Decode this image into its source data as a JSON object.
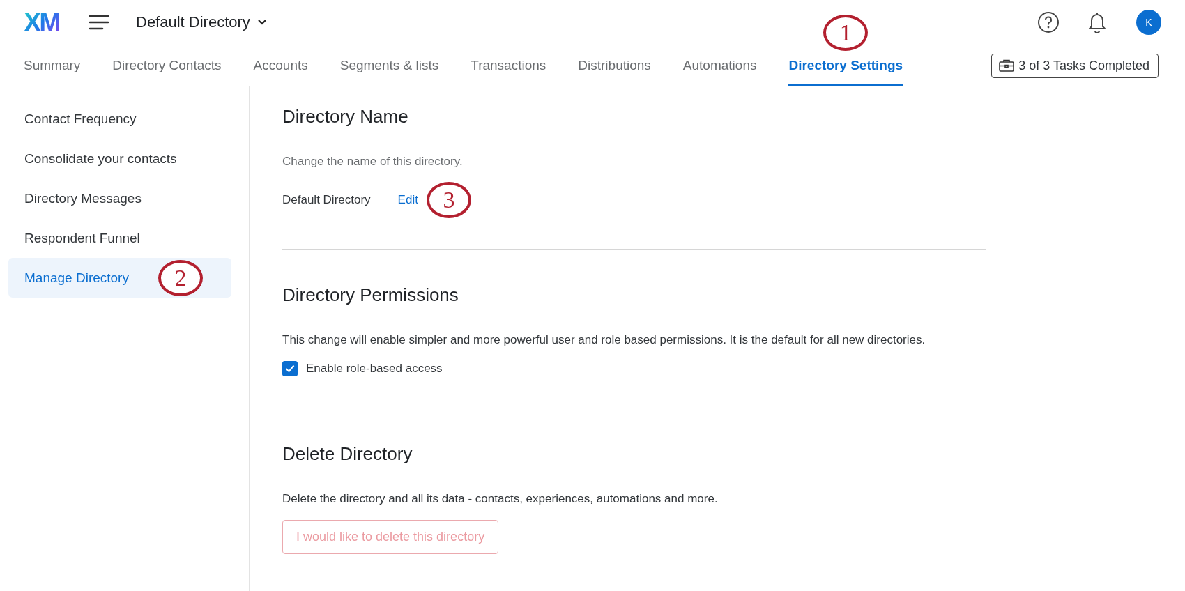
{
  "header": {
    "logo": "XM",
    "directory": "Default Directory",
    "avatar": "K"
  },
  "tabs": [
    {
      "label": "Summary",
      "selected": false
    },
    {
      "label": "Directory Contacts",
      "selected": false
    },
    {
      "label": "Accounts",
      "selected": false
    },
    {
      "label": "Segments & lists",
      "selected": false
    },
    {
      "label": "Transactions",
      "selected": false
    },
    {
      "label": "Distributions",
      "selected": false
    },
    {
      "label": "Automations",
      "selected": false
    },
    {
      "label": "Directory Settings",
      "selected": true,
      "callout": "1"
    }
  ],
  "tasks_button": "3 of 3 Tasks Completed",
  "sidebar": {
    "items": [
      {
        "label": "Contact Frequency",
        "selected": false
      },
      {
        "label": "Consolidate your contacts",
        "selected": false
      },
      {
        "label": "Directory Messages",
        "selected": false
      },
      {
        "label": "Respondent Funnel",
        "selected": false
      },
      {
        "label": "Manage Directory",
        "selected": true,
        "callout": "2"
      }
    ]
  },
  "sections": [
    {
      "kind": "name",
      "title": "Directory Name",
      "description": "Change the name of this directory.",
      "value": "Default Directory",
      "link": "Edit",
      "callout": "3"
    },
    {
      "kind": "checkbox",
      "title": "Directory Permissions",
      "description": "This change will enable simpler and more powerful user and role based permissions. It is the default for all new directories.",
      "checkbox": {
        "label": "Enable role-based access",
        "checked": true
      }
    },
    {
      "kind": "button",
      "title": "Delete Directory",
      "description": "Delete the directory and all its data - contacts, experiences, automations and more.",
      "button": {
        "label": "I would like to delete this directory",
        "disabled": true
      }
    }
  ]
}
